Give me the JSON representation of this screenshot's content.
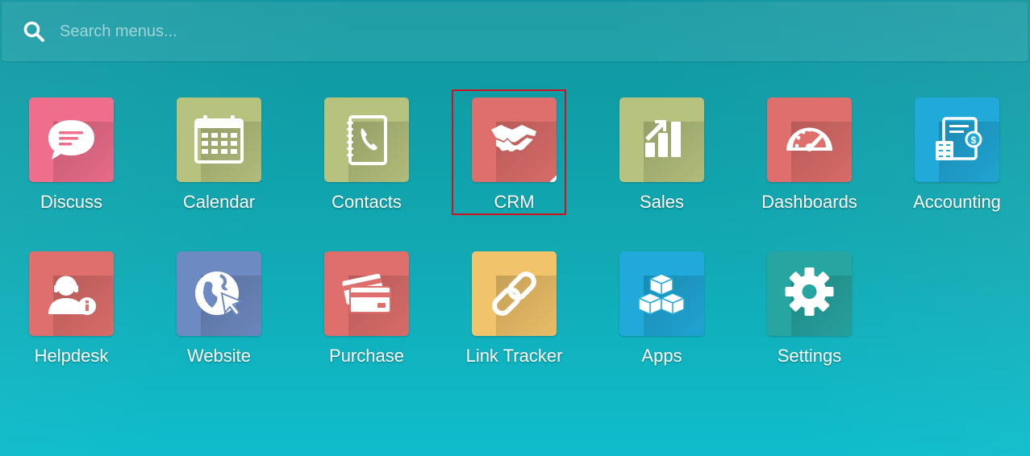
{
  "search": {
    "placeholder": "Search menus..."
  },
  "colors": {
    "background_top": "#0f959e",
    "background_bottom": "#0fbdcc",
    "highlight_border": "#d0121f",
    "pink": "#ee6e8c",
    "green": "#b6c27e",
    "salmon": "#de6f6c",
    "blue": "#21a9d9",
    "indigo": "#6e8ac2",
    "yellow": "#f1c36a",
    "teal": "#27a5a1"
  },
  "apps": [
    {
      "label": "Discuss",
      "icon": "chat-bubble-icon",
      "color": "#ee6e8c"
    },
    {
      "label": "Calendar",
      "icon": "calendar-icon",
      "color": "#b6c27e"
    },
    {
      "label": "Contacts",
      "icon": "address-book-icon",
      "color": "#b6c27e"
    },
    {
      "label": "CRM",
      "icon": "handshake-icon",
      "color": "#de6f6c",
      "badge": "check-badge-icon",
      "highlighted": true
    },
    {
      "label": "Sales",
      "icon": "bar-chart-icon",
      "color": "#b6c27e"
    },
    {
      "label": "Dashboards",
      "icon": "speedometer-icon",
      "color": "#de6f6c"
    },
    {
      "label": "Accounting",
      "icon": "invoice-calculator-icon",
      "color": "#21a9d9"
    },
    {
      "label": "Helpdesk",
      "icon": "support-agent-icon",
      "color": "#de6f6c"
    },
    {
      "label": "Website",
      "icon": "globe-cursor-icon",
      "color": "#6e8ac2"
    },
    {
      "label": "Purchase",
      "icon": "credit-cards-icon",
      "color": "#de6f6c"
    },
    {
      "label": "Link Tracker",
      "icon": "link-icon",
      "color": "#f1c36a"
    },
    {
      "label": "Apps",
      "icon": "cubes-icon",
      "color": "#21a9d9"
    },
    {
      "label": "Settings",
      "icon": "gear-icon",
      "color": "#27a5a1"
    }
  ]
}
